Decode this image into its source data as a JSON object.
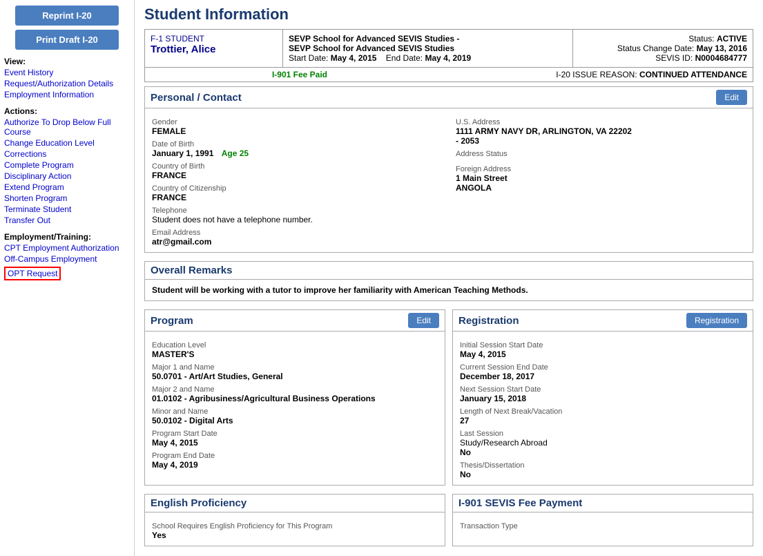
{
  "sidebar": {
    "btn_reprint": "Reprint I-20",
    "btn_draft": "Print Draft I-20",
    "view_label": "View:",
    "nav_event_history": "Event History",
    "nav_request_auth": "Request/Authorization Details",
    "nav_employment": "Employment Information",
    "actions_label": "Actions:",
    "nav_authorize": "Authorize To Drop Below Full Course",
    "nav_change_edu": "Change Education Level",
    "nav_corrections": "Corrections",
    "nav_complete": "Complete Program",
    "nav_disciplinary": "Disciplinary Action",
    "nav_extend": "Extend Program",
    "nav_shorten": "Shorten Program",
    "nav_terminate": "Terminate Student",
    "nav_transfer": "Transfer Out",
    "employment_label": "Employment/Training:",
    "nav_cpt": "CPT Employment Authorization",
    "nav_off_campus": "Off-Campus Employment",
    "nav_opt": "OPT Request"
  },
  "header": {
    "page_title": "Student Information",
    "student_type": "F-1 STUDENT",
    "student_name": "Trottier, Alice",
    "school_line1": "SEVP School for Advanced SEVIS Studies -",
    "school_line2": "SEVP School for Advanced SEVIS Studies",
    "start_date_label": "Start Date:",
    "start_date": "May 4, 2015",
    "end_date_label": "End Date:",
    "end_date": "May 4, 2019",
    "status_label": "Status:",
    "status_value": "ACTIVE",
    "status_change_label": "Status Change Date:",
    "status_change_date": "May 13, 2016",
    "sevis_label": "SEVIS ID:",
    "sevis_id": "N0004684777",
    "fee_paid": "I-901 Fee Paid",
    "issue_reason_label": "I-20 ISSUE REASON:",
    "issue_reason": "CONTINUED ATTENDANCE"
  },
  "personal_contact": {
    "section_title": "Personal / Contact",
    "edit_label": "Edit",
    "gender_label": "Gender",
    "gender": "FEMALE",
    "dob_label": "Date of Birth",
    "dob": "January 1, 1991",
    "age": "Age 25",
    "cob_label": "Country of Birth",
    "cob": "FRANCE",
    "coc_label": "Country of Citizenship",
    "coc": "FRANCE",
    "telephone_label": "Telephone",
    "telephone": "Student does not have a telephone number.",
    "email_label": "Email Address",
    "email": "atr@gmail.com",
    "us_address_label": "U.S. Address",
    "us_address_line1": "1111 ARMY NAVY DR,  ARLINGTON,  VA 22202",
    "us_address_line2": "- 2053",
    "us_address_status_label": "Address Status",
    "foreign_address_label": "Foreign Address",
    "foreign_address_line1": "1 Main Street",
    "foreign_address_line2": "ANGOLA"
  },
  "overall_remarks": {
    "section_title": "Overall Remarks",
    "text": "Student will be working with a tutor to improve her familiarity with American Teaching Methods."
  },
  "program": {
    "section_title": "Program",
    "edit_label": "Edit",
    "edu_level_label": "Education Level",
    "edu_level": "MASTER'S",
    "major1_label": "Major 1 and Name",
    "major1": "50.0701 - Art/Art Studies, General",
    "major2_label": "Major 2 and Name",
    "major2": "01.0102 - Agribusiness/Agricultural Business Operations",
    "minor_label": "Minor and Name",
    "minor": "50.0102 - Digital Arts",
    "prog_start_label": "Program Start Date",
    "prog_start": "May 4, 2015",
    "prog_end_label": "Program End Date",
    "prog_end": "May 4, 2019"
  },
  "registration": {
    "section_title": "Registration",
    "btn_label": "Registration",
    "init_session_label": "Initial Session Start Date",
    "init_session": "May 4, 2015",
    "curr_session_label": "Current Session End Date",
    "curr_session": "December 18, 2017",
    "next_session_label": "Next Session Start Date",
    "next_session": "January 15, 2018",
    "break_label": "Length of Next Break/Vacation",
    "break_value": "27",
    "last_session_label": "Last Session",
    "last_session": "Study/Research Abroad",
    "thesis_label": "Thesis/Dissertation",
    "thesis": "No",
    "last_session_value": "No"
  },
  "english_proficiency": {
    "section_title": "English Proficiency",
    "req_label": "School Requires English Proficiency for This Program",
    "req_value": "Yes"
  },
  "sevis_fee": {
    "section_title": "I-901 SEVIS Fee Payment",
    "transaction_label": "Transaction Type"
  }
}
